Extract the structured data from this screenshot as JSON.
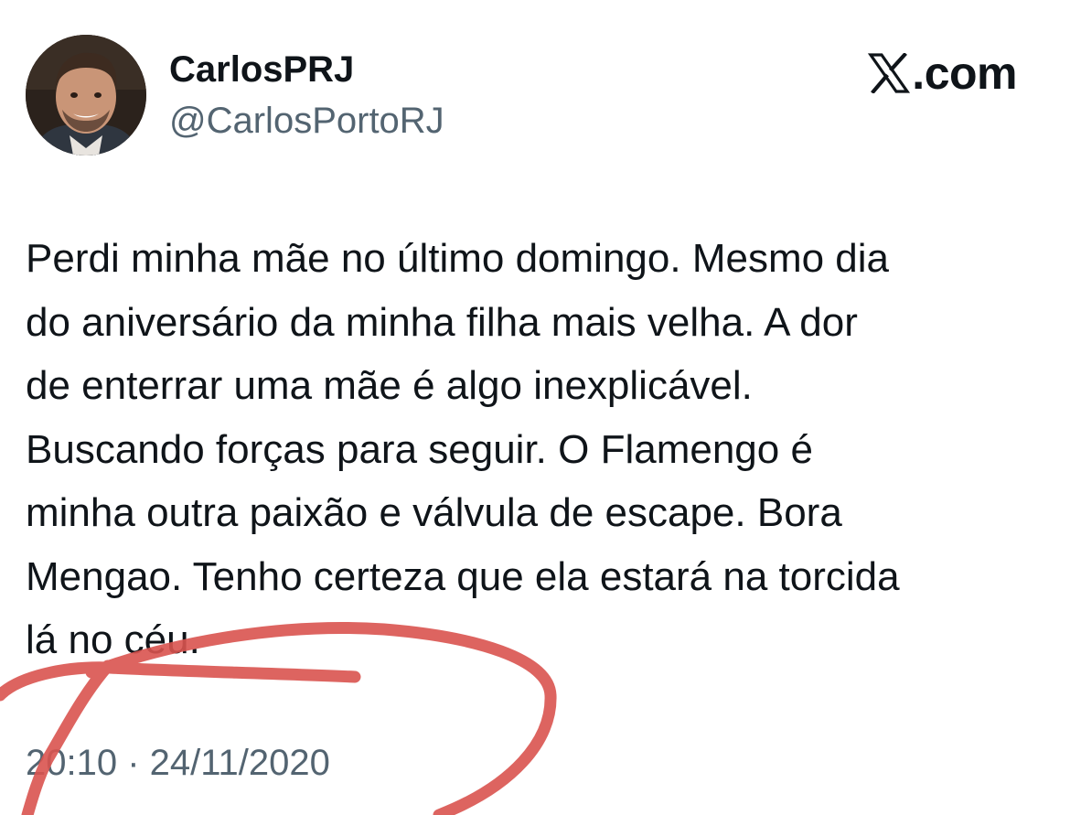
{
  "author": {
    "display_name": "CarlosPRJ",
    "handle": "@CarlosPortoRJ",
    "avatar": "profile-photo"
  },
  "brand": {
    "icon": "x-logo-icon",
    "text": ".com"
  },
  "tweet": {
    "lines": [
      "Perdi minha mãe no último domingo. Mesmo dia",
      "do aniversário da minha filha mais velha. A dor",
      "de enterrar uma mãe é algo inexplicável.",
      "Buscando forças para seguir. O Flamengo é",
      "minha outra paixão e válvula de escape. Bora",
      "Mengao. Tenho certeza que ela estará na torcida",
      "lá no céu."
    ],
    "timestamp": "20:10 · 24/11/2020"
  },
  "colors": {
    "text_primary": "#0f1419",
    "text_secondary": "#536471",
    "annotation_red": "#d9534f"
  },
  "annotation": "red-freehand-circle"
}
